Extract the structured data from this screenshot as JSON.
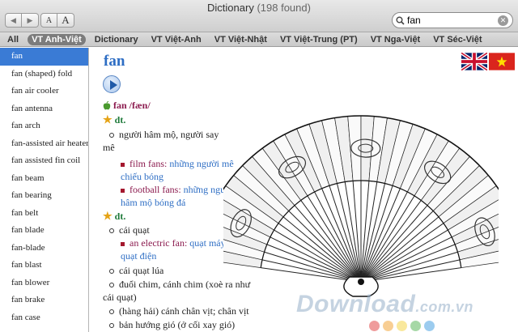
{
  "window": {
    "title": "Dictionary",
    "count": "(198 found)"
  },
  "toolbar": {
    "font_small": "A",
    "font_large": "A"
  },
  "search": {
    "value": "fan",
    "placeholder": ""
  },
  "tabs": [
    {
      "label": "All",
      "active": false
    },
    {
      "label": "VT Anh-Việt",
      "active": true
    },
    {
      "label": "Dictionary",
      "active": false
    },
    {
      "label": "VT Việt-Anh",
      "active": false
    },
    {
      "label": "VT Việt-Nhật",
      "active": false
    },
    {
      "label": "VT Việt-Trung (PT)",
      "active": false
    },
    {
      "label": "VT Nga-Việt",
      "active": false
    },
    {
      "label": "VT Séc-Việt",
      "active": false
    }
  ],
  "sidebar": {
    "items": [
      "fan",
      "fan (shaped) fold",
      "fan air cooler",
      "fan antenna",
      "fan arch",
      "fan-assisted air heater",
      "fan assisted fin coil",
      "fan beam",
      "fan bearing",
      "fan belt",
      "fan blade",
      "fan-blade",
      "fan blast",
      "fan blower",
      "fan brake",
      "fan case"
    ],
    "selected_index": 0
  },
  "entry": {
    "headword": "fan",
    "pronunciation_line": "fan /fæn/",
    "pos1": {
      "label": "dt.",
      "sense": "người hâm mộ, người say mê",
      "examples": [
        {
          "en": "film fans:",
          "vi": "những người mê chiếu bóng"
        },
        {
          "en": "football fans:",
          "vi": "những người hâm mộ bóng đá"
        }
      ]
    },
    "pos2": {
      "label": "dt.",
      "sense1": "cái quạt",
      "example": {
        "en": "an electric fan:",
        "vi": "quạt máy, quạt điện"
      },
      "sense2": "cái quạt lúa",
      "sense3": "đuổi chim, cánh chim (xoè ra như cái quạt)",
      "sense4": "(hàng hải) cánh chân vịt; chân vịt",
      "sense5": "bản hướng gió (ở cối xay gió)"
    }
  },
  "watermark": {
    "main": "Download",
    "suffix": ".com.vn"
  },
  "colors": {
    "selection": "#3a7bd5",
    "headword": "#2e6ec4",
    "pos": "#1e7a3a",
    "example_en": "#8b1a4e",
    "dots": [
      "#e24b4b",
      "#f2a53a",
      "#f4d64a",
      "#5cb85c",
      "#4aa3e2"
    ]
  }
}
